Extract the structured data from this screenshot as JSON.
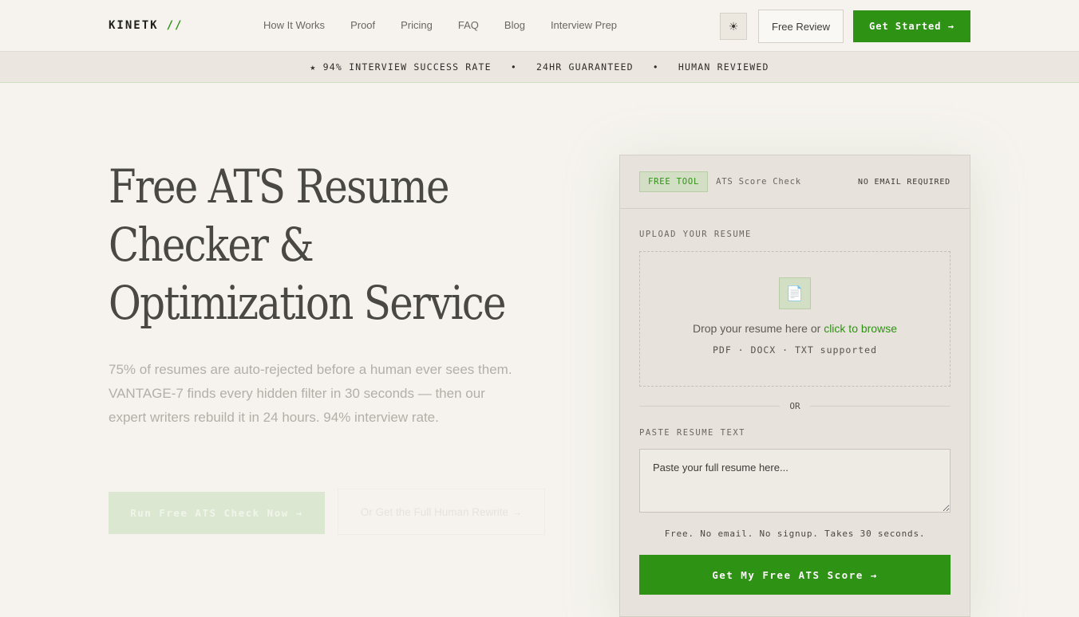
{
  "header": {
    "logo": "KINETK",
    "logo_mark": "//",
    "nav": [
      "How It Works",
      "Proof",
      "Pricing",
      "FAQ",
      "Blog",
      "Interview Prep"
    ],
    "theme_icon": "☀",
    "free_review": "Free Review",
    "get_started": "Get Started →"
  },
  "banner": {
    "items": [
      "★ 94% INTERVIEW SUCCESS RATE",
      "•",
      "24HR GUARANTEED",
      "•",
      "HUMAN REVIEWED"
    ]
  },
  "hero": {
    "title": "Free ATS Resume Checker & Optimization Service",
    "subtitle": "75% of resumes are auto-rejected before a human ever sees them. VANTAGE-7 finds every hidden filter in 30 seconds — then our expert writers rebuild it in 24 hours. 94% interview rate.",
    "cta_primary": "Run Free ATS Check Now →",
    "cta_secondary": "Or Get the Full Human Rewrite →"
  },
  "card": {
    "badge": "FREE TOOL",
    "tool_name": "ATS Score Check",
    "no_email": "NO EMAIL REQUIRED",
    "upload_label": "UPLOAD YOUR RESUME",
    "file_icon": "📄",
    "drop_text": "Drop your resume here or ",
    "browse_link": "click to browse",
    "formats": "PDF · DOCX · TXT supported",
    "or": "OR",
    "paste_label": "PASTE RESUME TEXT",
    "paste_placeholder": "Paste your full resume here...",
    "note": "Free. No email. No signup. Takes 30 seconds.",
    "submit": "Get My Free ATS Score →"
  },
  "colors": {
    "accent": "#2e9214",
    "bg": "#f6f3ee"
  }
}
